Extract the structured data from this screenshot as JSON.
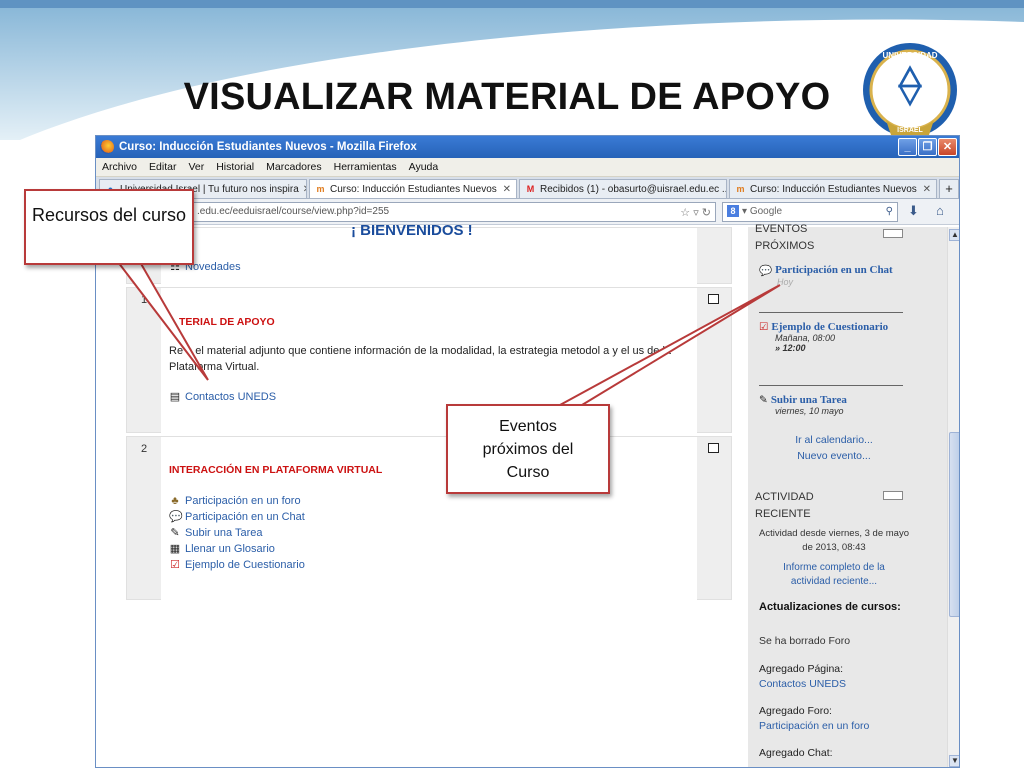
{
  "slide": {
    "title": "VISUALIZAR MATERIAL DE APOYO",
    "seal_text_top": "UNIVERSIDAD",
    "seal_text_bottom": "ISRAEL"
  },
  "window": {
    "title": "Curso: Inducción Estudiantes Nuevos - Mozilla Firefox",
    "controls": [
      "_",
      "❐",
      "✕"
    ]
  },
  "menu": [
    "Archivo",
    "Editar",
    "Ver",
    "Historial",
    "Marcadores",
    "Herramientas",
    "Ayuda"
  ],
  "tabs": [
    {
      "label": "Universidad Israel | Tu futuro nos inspira",
      "icon": "globe-icon",
      "active": false
    },
    {
      "label": "Curso: Inducción Estudiantes Nuevos",
      "icon": "moodle-icon",
      "active": true
    },
    {
      "label": "Recibidos (1) - obasurto@uisrael.edu.ec ...",
      "icon": "gmail-icon",
      "active": false
    },
    {
      "label": "Curso: Inducción Estudiantes Nuevos",
      "icon": "moodle-icon",
      "active": false
    }
  ],
  "newtab_label": "+",
  "address": {
    "url": ".edu.ec/eeduisrael/course/view.php?id=255",
    "search_placeholder": "Google"
  },
  "course": {
    "welcome": "¡ BIENVENIDOS !",
    "news": "Novedades",
    "sections": [
      {
        "num": "1",
        "heading": "TERIAL DE APOYO",
        "text": "Re   e el material adjunto que contiene información de la modalidad, la estrategia metodol   a y el us   de la Plataforma Virtual.",
        "resources": [
          "Contactos UNEDS"
        ]
      },
      {
        "num": "2",
        "heading": "INTERACCIÓN EN PLATAFORMA VIRTUAL",
        "resources": [
          "Participación en un foro",
          "Participación en un Chat",
          "Subir una Tarea",
          "Llenar un Glosario",
          "Ejemplo de Cuestionario"
        ]
      }
    ]
  },
  "sidebar": {
    "events_title_1": "EVENTOS",
    "events_title_2": "PRÓXIMOS",
    "events": [
      {
        "title": "Participación en un Chat",
        "dates": [
          "Hoy"
        ]
      },
      {
        "title": "Ejemplo de Cuestionario",
        "dates": [
          "Mañana, 08:00",
          "» 12:00"
        ]
      },
      {
        "title": "Subir una Tarea",
        "dates": [
          "viernes, 10 mayo"
        ]
      }
    ],
    "calendar_link": "Ir al calendario...",
    "new_event_link": "Nuevo evento...",
    "activity_title_1": "ACTIVIDAD",
    "activity_title_2": "RECIENTE",
    "activity_since": "Actividad desde viernes, 3 de mayo de 2013, 08:43",
    "activity_report": "Informe completo de la actividad reciente...",
    "updates_title": "Actualizaciones de cursos:",
    "updates": [
      {
        "label": "Se ha borrado Foro",
        "link": ""
      },
      {
        "label": "Agregado Página:",
        "link": "Contactos UNEDS"
      },
      {
        "label": "Agregado Foro:",
        "link": "Participación en un foro"
      },
      {
        "label": "Agregado Chat:",
        "link": ""
      }
    ]
  },
  "callouts": {
    "resources": "Recursos del curso",
    "events": "Eventos próximos del Curso"
  },
  "colors": {
    "accent_red": "#cc1111",
    "link_blue": "#2b5ea8",
    "callout_border": "#b83a3a",
    "titlebar_blue": "#2662b8"
  }
}
